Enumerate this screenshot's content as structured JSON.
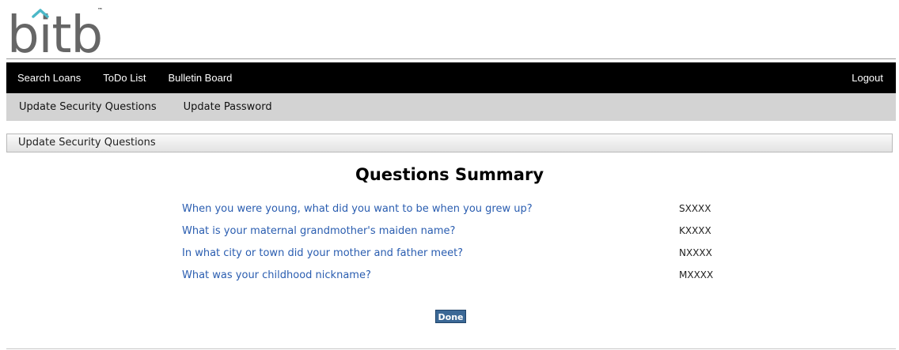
{
  "brand": {
    "logo_text": "bitb",
    "trademark": "™"
  },
  "main_nav": {
    "items": [
      "Search Loans",
      "ToDo List",
      "Bulletin Board"
    ],
    "logout": "Logout"
  },
  "sub_nav": {
    "items": [
      "Update Security Questions",
      "Update Password"
    ]
  },
  "section": {
    "title": "Update Security Questions"
  },
  "summary": {
    "title": "Questions Summary",
    "rows": [
      {
        "question": "When you were young, what did you want to be when you grew up?",
        "answer": "SXXXX"
      },
      {
        "question": "What is your maternal grandmother's maiden name?",
        "answer": "KXXXX"
      },
      {
        "question": "In what city or town did your mother and father meet?",
        "answer": "NXXXX"
      },
      {
        "question": "What was your childhood nickname?",
        "answer": "MXXXX"
      }
    ]
  },
  "actions": {
    "done_label": "Done"
  },
  "colors": {
    "nav_bg": "#000000",
    "subnav_bg": "#d3d3d3",
    "link": "#2a5db0",
    "button_bg": "#3b6896"
  }
}
